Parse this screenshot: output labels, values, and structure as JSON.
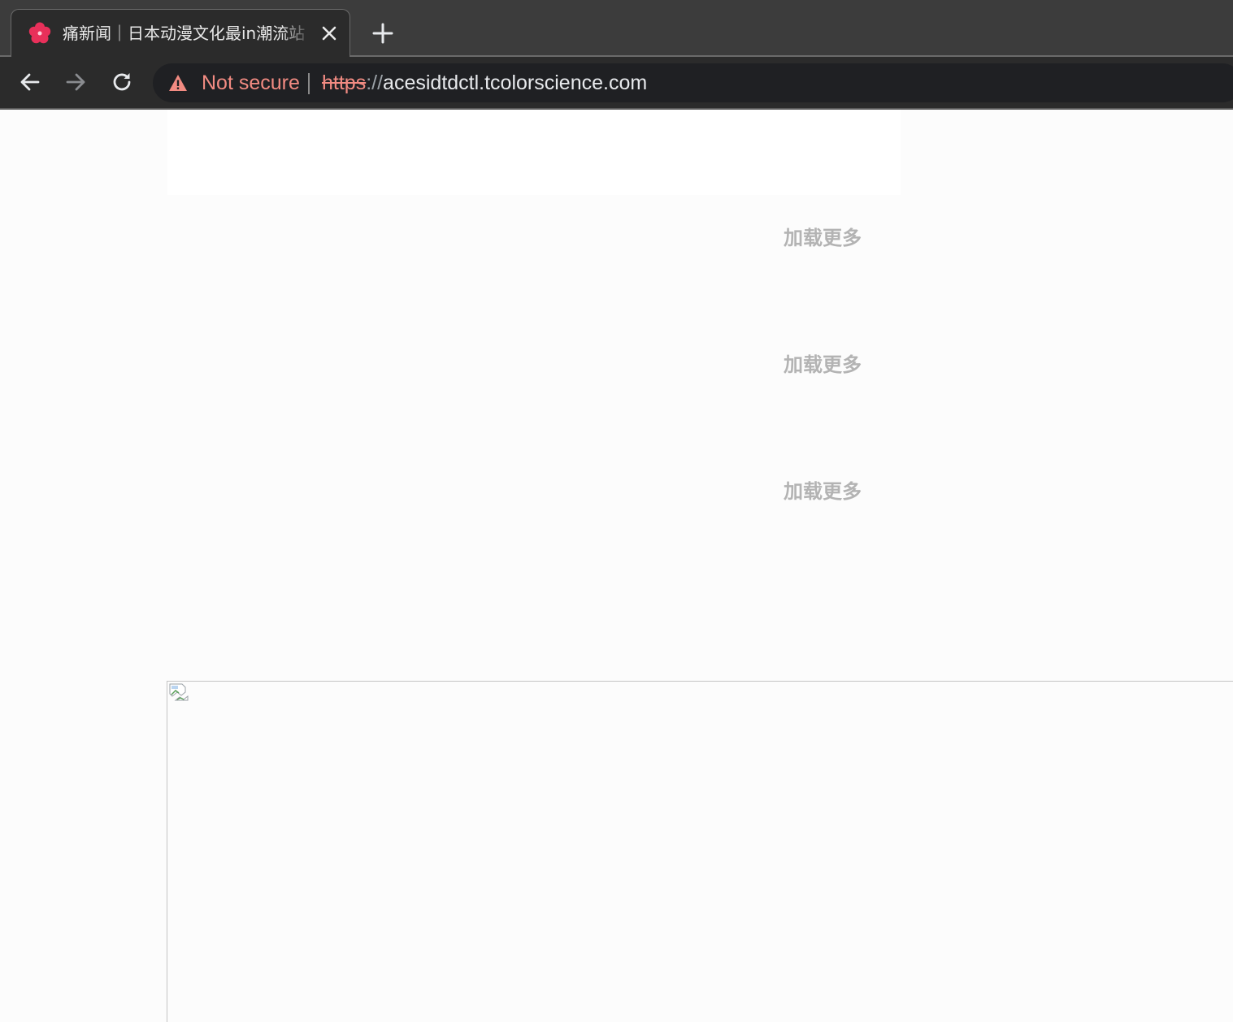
{
  "browser": {
    "tab": {
      "title": "痛新闻｜日本动漫文化最in潮流站",
      "favicon": "cherry-blossom-icon",
      "favicon_color": "#e8305a"
    },
    "address_bar": {
      "security_label": "Not secure",
      "security_color": "#f28b82",
      "url_scheme": "https",
      "url_separator": "://",
      "url_host": "acesidtdctl.tcolorscience.com"
    }
  },
  "page": {
    "load_more_buttons": [
      {
        "label": "加载更多"
      },
      {
        "label": "加载更多"
      },
      {
        "label": "加载更多"
      }
    ]
  }
}
